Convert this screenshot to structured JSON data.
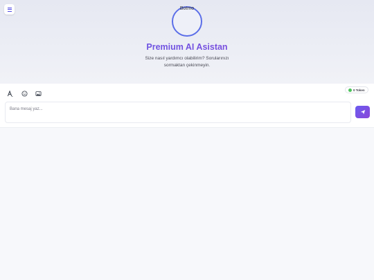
{
  "header": {
    "menu_icon": "hamburger-menu-icon",
    "avatar_alt": "Botmo",
    "title": "Premium AI Asistan",
    "subtitle": "Size nasıl yardımcı olabilirim? Sorularınızı sormaktan çekinmeyin."
  },
  "toolbar": {
    "icons": [
      "font-icon",
      "emoji-icon",
      "image-icon"
    ],
    "token_label": "0 Token",
    "token_color": "#4cc35a"
  },
  "composer": {
    "placeholder": "Bana mesaj yaz...",
    "send_icon": "send-icon"
  },
  "colors": {
    "accent_start": "#5b5ce8",
    "accent_end": "#8a45d8",
    "avatar_border": "#5b6ee8"
  }
}
